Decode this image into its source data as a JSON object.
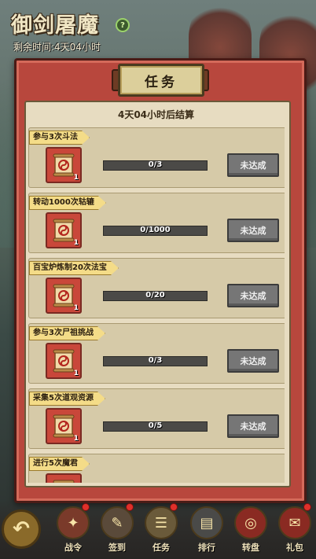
{
  "event": {
    "title": "御剑屠魔",
    "remaining": "剩余时间:4天04小时"
  },
  "panel": {
    "title": "任务",
    "settle_text": "4天04小时后结算"
  },
  "tasks": [
    {
      "name": "参与3次斗法",
      "progress": "0/3",
      "fraction": 0,
      "reward_count": "1",
      "status": "未达成"
    },
    {
      "name": "转动1000次轱辘",
      "progress": "0/1000",
      "fraction": 0,
      "reward_count": "1",
      "status": "未达成"
    },
    {
      "name": "百宝炉炼制20次法宝",
      "progress": "0/20",
      "fraction": 0,
      "reward_count": "1",
      "status": "未达成"
    },
    {
      "name": "参与3次尸祖挑战",
      "progress": "0/3",
      "fraction": 0,
      "reward_count": "1",
      "status": "未达成"
    },
    {
      "name": "采集5次道观资源",
      "progress": "0/5",
      "fraction": 0,
      "reward_count": "1",
      "status": "未达成"
    },
    {
      "name": "进行5次魔君",
      "progress": "",
      "fraction": 0,
      "reward_count": "",
      "status": ""
    }
  ],
  "nav": [
    {
      "label": "战令",
      "icon": "war-order-icon",
      "badge": true
    },
    {
      "label": "签到",
      "icon": "sign-in-icon",
      "badge": true
    },
    {
      "label": "任务",
      "icon": "task-icon",
      "badge": true
    },
    {
      "label": "排行",
      "icon": "ranking-icon",
      "badge": false
    },
    {
      "label": "转盘",
      "icon": "wheel-icon",
      "badge": false
    },
    {
      "label": "礼包",
      "icon": "gift-icon",
      "badge": true
    }
  ],
  "colors": {
    "panel_red": "#b8473d",
    "parchment": "#e7dcc1",
    "tag_yellow": "#f4dc88",
    "button_gray": "#767676"
  }
}
